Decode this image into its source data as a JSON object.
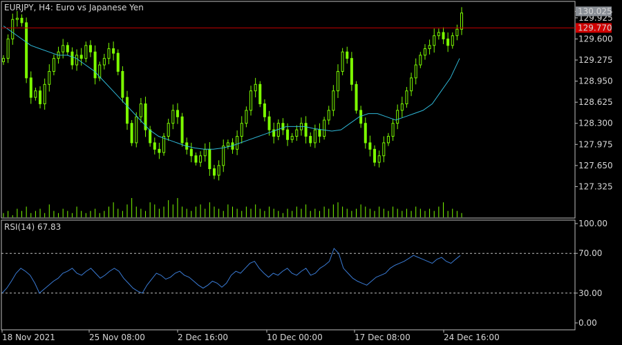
{
  "header": {
    "title": "EURJPY, H4:  Euro vs Japanese Yen"
  },
  "colors": {
    "background": "#000000",
    "frame": "#bfbfbf",
    "candles": "#7CFC00",
    "moving_average": "#2fb8d8",
    "rsi_line": "#3a7bd5",
    "bid_line": "#c00000",
    "bid_badge": "#d00000",
    "ask_badge": "#8a8f96",
    "text": "#d6d6d6"
  },
  "chart_data": [
    {
      "type": "candlestick",
      "title": "EURJPY, H4:  Euro vs Japanese Yen",
      "y_ticks": [
        "130.025",
        "129.925",
        "129.600",
        "129.275",
        "128.950",
        "128.625",
        "128.300",
        "127.975",
        "127.650",
        "127.325"
      ],
      "ylim": [
        127.17,
        130.03
      ],
      "x_ticks": [
        "18 Nov 2021",
        "25 Nov 08:00",
        "2 Dec 16:00",
        "10 Dec 00:00",
        "17 Dec 08:00",
        "24 Dec 16:00"
      ],
      "grid": false,
      "current_price_labels": [
        {
          "text": "130.025",
          "value": 130.025
        },
        {
          "text": "129.770",
          "value": 129.77
        }
      ],
      "close_series": [
        129.3,
        129.6,
        129.9,
        129.92,
        129.85,
        129.0,
        128.7,
        128.8,
        128.6,
        128.9,
        129.1,
        129.3,
        129.4,
        129.5,
        129.4,
        129.2,
        129.35,
        129.3,
        129.5,
        129.4,
        129.0,
        129.2,
        129.3,
        129.45,
        129.38,
        129.1,
        128.7,
        128.3,
        128.0,
        128.4,
        128.6,
        128.2,
        128.0,
        127.9,
        127.85,
        128.1,
        128.3,
        128.5,
        128.4,
        128.0,
        127.9,
        127.8,
        127.7,
        127.8,
        127.9,
        127.6,
        127.5,
        127.65,
        127.95,
        128.0,
        127.9,
        128.1,
        128.3,
        128.5,
        128.8,
        128.9,
        128.6,
        128.4,
        128.2,
        128.1,
        128.3,
        128.2,
        128.05,
        128.1,
        128.2,
        128.3,
        128.1,
        128.0,
        128.2,
        128.1,
        128.35,
        128.5,
        128.8,
        129.1,
        129.4,
        129.3,
        128.9,
        128.5,
        128.3,
        128.0,
        127.9,
        127.7,
        127.8,
        128.0,
        128.1,
        128.3,
        128.5,
        128.6,
        128.8,
        129.0,
        129.2,
        129.35,
        129.45,
        129.5,
        129.65,
        129.7,
        129.6,
        129.5,
        129.65,
        129.75,
        130.0
      ],
      "ma_series": [
        129.8,
        129.7,
        129.6,
        129.5,
        129.45,
        129.4,
        129.35,
        129.35,
        129.3,
        129.2,
        129.1,
        128.95,
        128.8,
        128.65,
        128.5,
        128.35,
        128.2,
        128.1,
        128.05,
        128.0,
        127.95,
        127.92,
        127.9,
        127.9,
        127.92,
        127.95,
        128.0,
        128.05,
        128.1,
        128.15,
        128.2,
        128.25,
        128.25,
        128.25,
        128.22,
        128.2,
        128.18,
        128.2,
        128.3,
        128.4,
        128.45,
        128.45,
        128.4,
        128.35,
        128.4,
        128.45,
        128.5,
        128.6,
        128.8,
        129.0,
        129.3
      ],
      "volume_series": [
        2,
        3,
        1,
        4,
        3,
        5,
        2,
        3,
        4,
        2,
        6,
        3,
        2,
        4,
        3,
        2,
        5,
        3,
        2,
        3,
        4,
        2,
        3,
        5,
        7,
        4,
        3,
        6,
        9,
        5,
        4,
        3,
        7,
        6,
        4,
        5,
        8,
        6,
        9,
        5,
        4,
        3,
        5,
        6,
        4,
        7,
        5,
        4,
        3,
        6,
        5,
        4,
        3,
        5,
        4,
        6,
        4,
        3,
        5,
        4,
        3,
        2,
        4,
        3,
        5,
        4,
        6,
        3,
        4,
        3,
        5,
        4,
        6,
        7,
        5,
        4,
        3,
        4,
        6,
        5,
        4,
        3,
        5,
        4,
        3,
        5,
        4,
        3,
        4,
        3,
        5,
        4,
        3,
        4,
        3,
        5,
        7,
        3,
        4,
        3,
        2
      ]
    },
    {
      "type": "line",
      "title": "RSI(14) 67.83",
      "series": [
        {
          "name": "RSI(14)",
          "values": [
            30,
            35,
            42,
            50,
            55,
            52,
            48,
            40,
            30,
            34,
            38,
            42,
            45,
            50,
            52,
            55,
            50,
            48,
            52,
            55,
            50,
            45,
            48,
            52,
            55,
            52,
            45,
            40,
            35,
            32,
            30,
            38,
            44,
            50,
            48,
            44,
            46,
            50,
            52,
            48,
            46,
            42,
            38,
            35,
            38,
            42,
            40,
            36,
            40,
            48,
            52,
            50,
            55,
            60,
            62,
            55,
            50,
            46,
            50,
            48,
            52,
            55,
            50,
            48,
            52,
            55,
            48,
            50,
            55,
            58,
            62,
            75,
            70,
            55,
            50,
            45,
            42,
            40,
            38,
            42,
            46,
            48,
            50,
            55,
            58,
            60,
            62,
            65,
            68,
            66,
            64,
            62,
            60,
            64,
            66,
            62,
            60,
            64,
            67.83
          ]
        }
      ],
      "y_ticks": [
        "100.00",
        "70.00",
        "30.00",
        "0.00"
      ],
      "ylim": [
        0,
        100
      ],
      "levels": [
        70,
        30
      ]
    }
  ]
}
